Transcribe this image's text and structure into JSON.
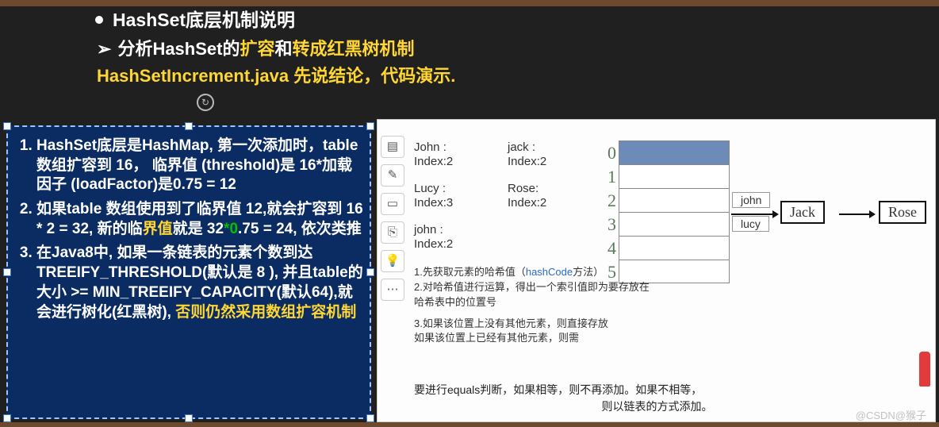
{
  "header": {
    "title": "HashSet底层机制说明",
    "line2_prefix": "分析HashSet的",
    "line2_y1": "扩容",
    "line2_mid": "和",
    "line2_y2": "转成红黑树机制",
    "line3": "HashSetIncrement.java  先说结论，代码演示."
  },
  "leftbox": {
    "item1": "HashSet底层是HashMap, 第一次添加时，table 数组扩容到 16， 临界值 (threshold)是 16*加载因子 (loadFactor)是0.75 = 12",
    "item2_a": "如果table 数组使用到了临界值 12,就会扩容到 16 * 2 = 32, 新的临",
    "item2_hl": "界值",
    "item2_b": "就是 32",
    "item2_star": "*",
    "item2_g": "0",
    "item2_c": ".75 = 24, 依次类推",
    "item3_a": "在Java8中, 如果一条链表的元素个数到达 TREEIFY_THRESHOLD(默认是 8 ), 并且table的大小 >= MIN_TREEIFY_CAPACITY(默认64),就会进行树化(红黑树), ",
    "item3_y": "否则仍然采用数组扩容机制"
  },
  "toolbar": {
    "b1": "layers-icon",
    "b2": "brush-icon",
    "b3": "rect-icon",
    "b4": "page-icon",
    "b5": "bulb-icon",
    "b6": "more-icon"
  },
  "entries": {
    "c1": [
      {
        "n": "John :",
        "i": "Index:2"
      },
      {
        "n": "Lucy :",
        "i": "Index:3"
      },
      {
        "n": "john :",
        "i": "Index:2"
      }
    ],
    "c2": [
      {
        "n": "jack :",
        "i": "Index:2"
      },
      {
        "n": "Rose:",
        "i": "Index:2"
      }
    ]
  },
  "table": {
    "hnums": [
      "0",
      "1",
      "2",
      "3",
      "4",
      "5"
    ],
    "row2_label": "john",
    "row3_label": "lucy"
  },
  "chain": {
    "b1": "Jack",
    "b2": "Rose"
  },
  "notes": {
    "n1a": "1.先获取元素的哈希值（",
    "n1en": "hashCode",
    "n1b": "方法）",
    "n2": "2.对哈希值进行运算，得出一个索引值即为要存放在哈希表中的位置号",
    "n3": "3.如果该位置上没有其他元素，则直接存放",
    "n4": "如果该位置上已经有其他元素，则需"
  },
  "bottom": {
    "l1a": "要进行",
    "l1en": "equals",
    "l1b": "判断，如果相等，则不再添加。如果不相等，",
    "l2": "则以链表的方式添加。"
  },
  "watermark": "@CSDN@猴子"
}
